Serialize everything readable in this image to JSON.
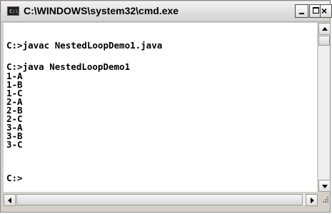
{
  "window": {
    "title": "C:\\WINDOWS\\system32\\cmd.exe",
    "icon": "console-icon",
    "icon_text": "C:\\"
  },
  "title_buttons": {
    "minimize": "minimize-icon",
    "maximize": "maximize-icon",
    "close": "close-icon",
    "close_glyph": "×"
  },
  "console": {
    "lines": [
      "",
      "C:>javac NestedLoopDemo1.java",
      "",
      "C:>java NestedLoopDemo1",
      "1-A",
      "1-B",
      "1-C",
      "2-A",
      "2-B",
      "2-C",
      "3-A",
      "3-B",
      "3-C",
      "",
      "C:>"
    ]
  },
  "scrollbars": {
    "vertical_position": 0.0,
    "horizontal_position": 0.0
  },
  "colors": {
    "console_background": "#ffffff",
    "console_text": "#000000"
  }
}
